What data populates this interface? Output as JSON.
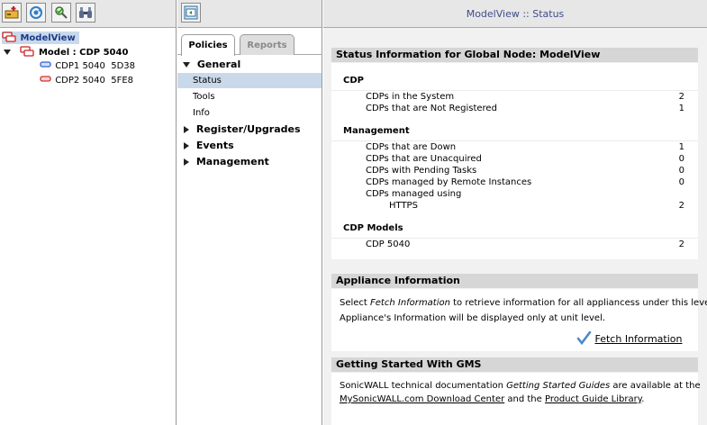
{
  "tree": {
    "root": "ModelView",
    "model": "Model : CDP 5040",
    "units": [
      {
        "label": "CDP1 5040  5D38",
        "color": "#3060d0"
      },
      {
        "label": "CDP2 5040  5FE8",
        "color": "#d03030"
      }
    ]
  },
  "nav": {
    "tabs": [
      "Policies",
      "Reports"
    ],
    "general": "General",
    "general_items": [
      "Status",
      "Tools",
      "Info"
    ],
    "sections": [
      "Register/Upgrades",
      "Events",
      "Management"
    ]
  },
  "page_title": "ModelView :: Status",
  "status": {
    "heading": "Status Information for Global Node: ModelView",
    "cdp": {
      "title": "CDP",
      "rows": [
        {
          "label": "CDPs in the System",
          "value": "2"
        },
        {
          "label": "CDPs that are Not Registered",
          "value": "1"
        }
      ]
    },
    "management": {
      "title": "Management",
      "rows": [
        {
          "label": "CDPs that are Down",
          "value": "1"
        },
        {
          "label": "CDPs that are Unacquired",
          "value": "0"
        },
        {
          "label": "CDPs with Pending Tasks",
          "value": "0"
        },
        {
          "label": "CDPs managed by Remote Instances",
          "value": "0"
        },
        {
          "label": "CDPs managed using",
          "value": ""
        },
        {
          "label": "HTTPS",
          "value": "2"
        }
      ]
    },
    "models": {
      "title": "CDP Models",
      "rows": [
        {
          "label": "CDP 5040",
          "value": "2"
        }
      ]
    }
  },
  "appliance": {
    "heading": "Appliance Information",
    "line1_pre": "Select ",
    "line1_em": "Fetch Information",
    "line1_post": " to retrieve information for all appliancess under this level.",
    "line2": "Appliance's Information will be displayed only at unit level.",
    "fetch_label": "Fetch Information"
  },
  "getting_started": {
    "heading": "Getting Started With GMS",
    "line1_pre": "SonicWALL technical documentation ",
    "line1_em": "Getting Started Guides",
    "line1_post": " are available at the",
    "link1": "MySonicWALL.com Download Center",
    "and": " and the ",
    "link2": "Product Guide Library",
    "end": "."
  }
}
